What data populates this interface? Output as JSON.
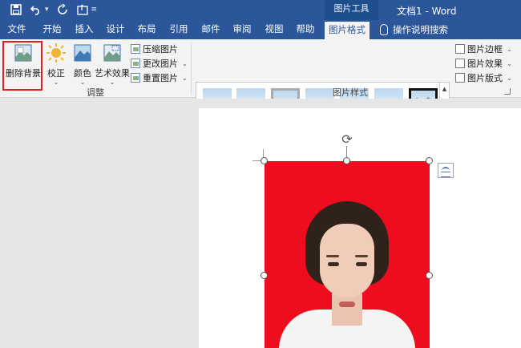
{
  "titlebar": {
    "context_group": "图片工具",
    "document_title": "文档1 - Word"
  },
  "tabs": [
    {
      "label": "文件"
    },
    {
      "label": "开始"
    },
    {
      "label": "插入"
    },
    {
      "label": "设计"
    },
    {
      "label": "布局"
    },
    {
      "label": "引用"
    },
    {
      "label": "邮件"
    },
    {
      "label": "审阅"
    },
    {
      "label": "视图"
    },
    {
      "label": "帮助"
    },
    {
      "label": "图片格式",
      "active": true
    }
  ],
  "tell_me": "操作说明搜索",
  "ribbon": {
    "adjust": {
      "label": "调整",
      "remove_background": "删除背景",
      "corrections": "校正",
      "color": "颜色",
      "artistic_effects": "艺术效果",
      "compress": "压缩图片",
      "change": "更改图片",
      "reset": "重置图片"
    },
    "styles": {
      "label": "图片样式",
      "border": "图片边框",
      "effects": "图片效果",
      "layout": "图片版式"
    }
  },
  "colors": {
    "title_bar": "#2b579a",
    "highlight": "#e0201d",
    "photo_background": "#ee0d1f"
  }
}
